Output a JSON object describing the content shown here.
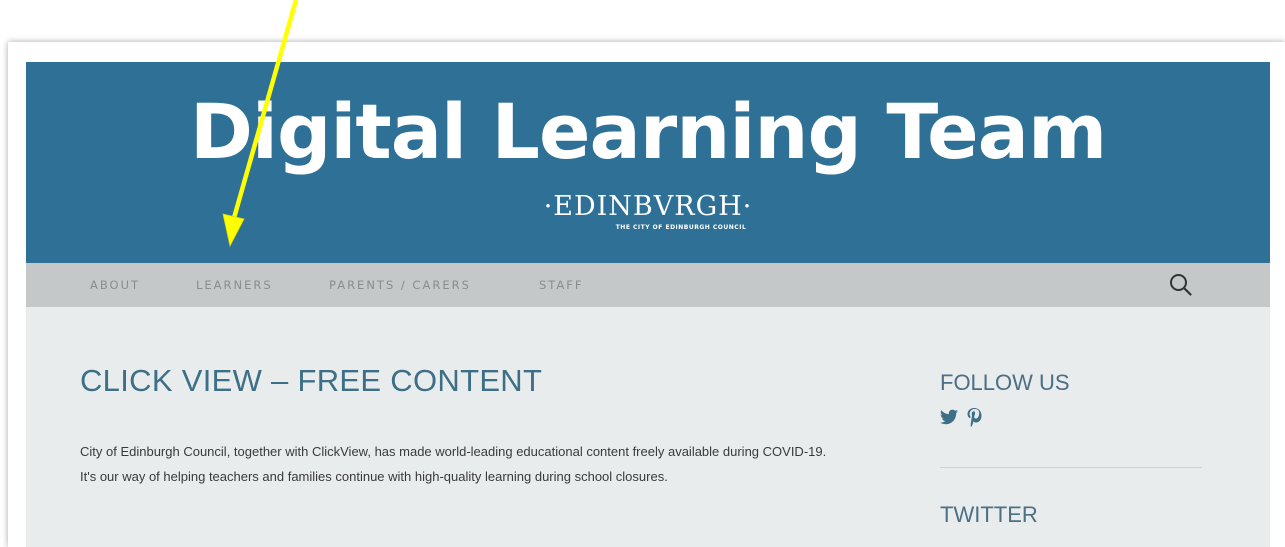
{
  "header": {
    "site_title": "Digital Learning Team",
    "logo_text": "·EDINBVRGH·",
    "logo_subtext": "THE CITY OF EDINBURGH COUNCIL",
    "background_color": "#2f7196"
  },
  "nav": {
    "items": [
      {
        "label": "ABOUT"
      },
      {
        "label": "LEARNERS"
      },
      {
        "label": "PARENTS / CARERS"
      },
      {
        "label": "STAFF"
      }
    ],
    "search_icon": "search-icon",
    "background_color": "#c5c8c9"
  },
  "main": {
    "post_title": "CLICK VIEW – FREE CONTENT",
    "post_body": "City of Edinburgh Council, together with ClickView, has made world-leading educational content freely available during COVID-19. It's our way of helping teachers and families continue with high-quality learning during school closures.",
    "title_color": "#3d6f87"
  },
  "sidebar": {
    "follow_title": "FOLLOW US",
    "social_icons": [
      "twitter-icon",
      "pinterest-icon"
    ],
    "twitter_title": "TWITTER"
  },
  "annotation": {
    "arrow_color": "#ffff00"
  }
}
